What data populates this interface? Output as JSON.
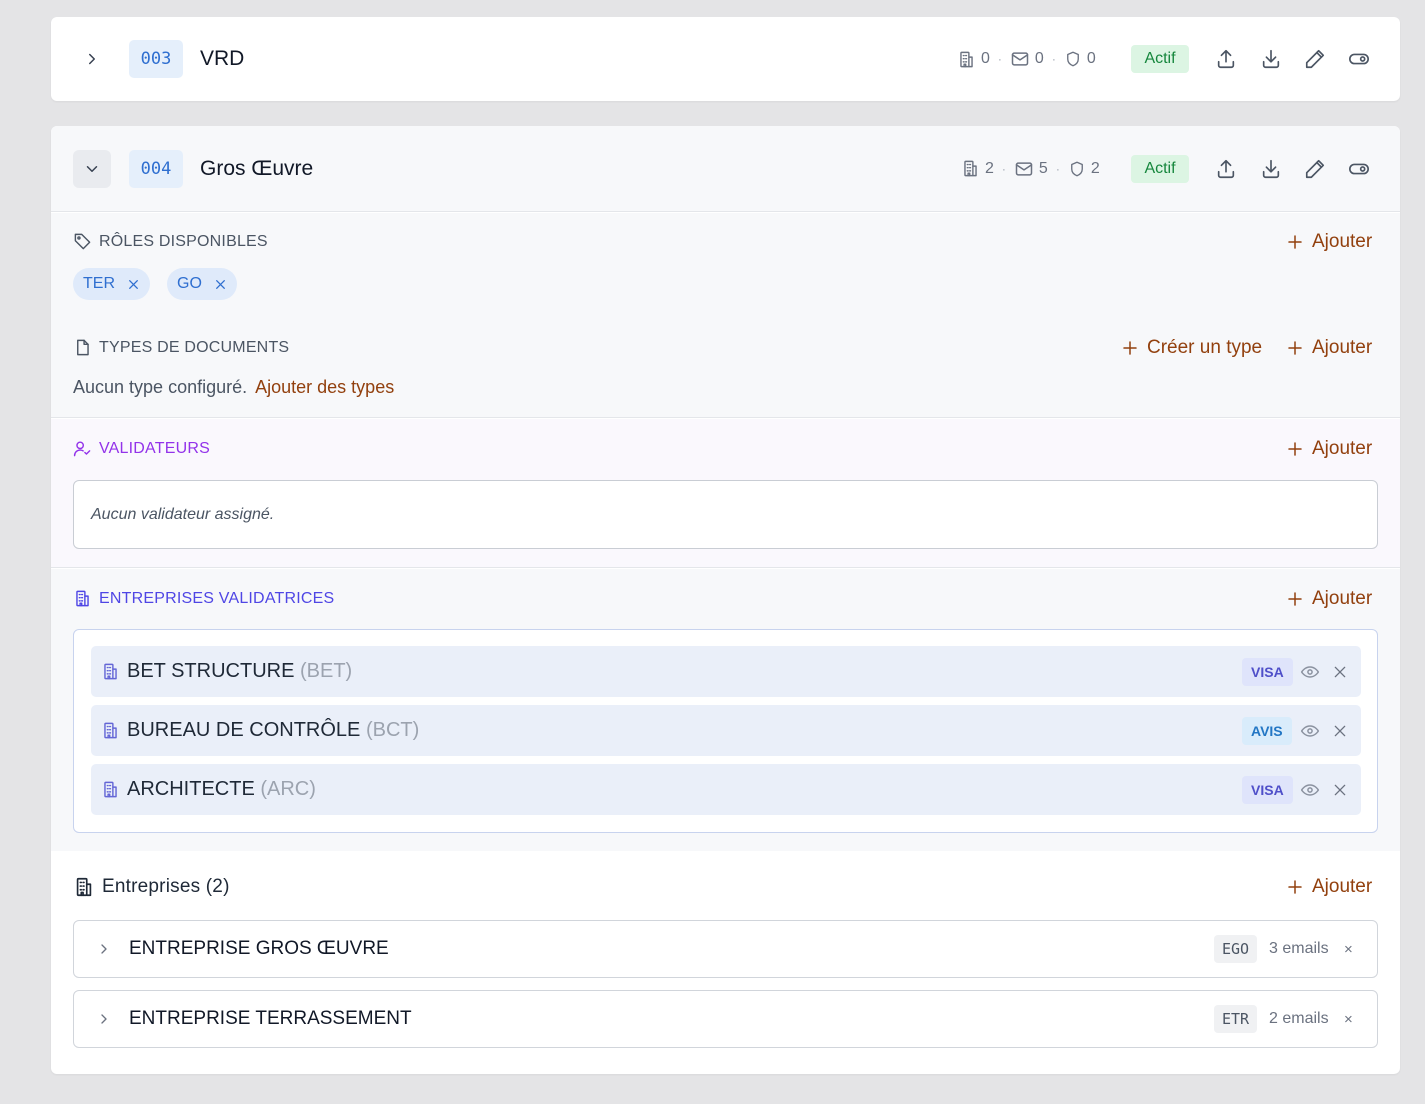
{
  "colors": {
    "accent_link": "#92400e",
    "code_blue": "#2f6fd0",
    "actif_green": "#16873d",
    "validateurs_purple": "#9333ea",
    "entreprises_indigo": "#4f46e5"
  },
  "lots": [
    {
      "code": "003",
      "title": "VRD",
      "expanded": false,
      "stats": {
        "companies": "0",
        "emails": "0",
        "validators": "0"
      },
      "status": "Actif"
    },
    {
      "code": "004",
      "title": "Gros Œuvre",
      "expanded": true,
      "stats": {
        "companies": "2",
        "emails": "5",
        "validators": "2"
      },
      "status": "Actif",
      "roles": {
        "label": "RÔLES DISPONIBLES",
        "add_label": "Ajouter",
        "chips": [
          "TER",
          "GO"
        ]
      },
      "doc_types": {
        "label": "TYPES DE DOCUMENTS",
        "create_label": "Créer un type",
        "add_label": "Ajouter",
        "empty_text": "Aucun type configuré.",
        "empty_link": "Ajouter des types"
      },
      "validators": {
        "label": "VALIDATEURS",
        "add_label": "Ajouter",
        "empty_text": "Aucun validateur assigné."
      },
      "validating_companies": {
        "label": "ENTREPRISES VALIDATRICES",
        "add_label": "Ajouter",
        "items": [
          {
            "name": "BET STRUCTURE",
            "abbr": "(BET)",
            "role": "VISA"
          },
          {
            "name": "BUREAU DE CONTRÔLE",
            "abbr": "(BCT)",
            "role": "AVIS"
          },
          {
            "name": "ARCHITECTE",
            "abbr": "(ARC)",
            "role": "VISA"
          }
        ]
      },
      "companies": {
        "label": "Entreprises (2)",
        "add_label": "Ajouter",
        "items": [
          {
            "name": "ENTREPRISE GROS ŒUVRE",
            "code": "EGO",
            "emails": "3 emails"
          },
          {
            "name": "ENTREPRISE TERRASSEMENT",
            "code": "ETR",
            "emails": "2 emails"
          }
        ]
      }
    }
  ],
  "icons": {
    "chevron_closed": "chevron-right-icon",
    "chevron_open": "chevron-down-icon",
    "stat_companies": "building-icon",
    "stat_emails": "mail-icon",
    "stat_validators": "shield-icon",
    "upload": "upload-icon",
    "download": "download-icon",
    "edit": "pencil-icon",
    "toggle": "toggle-icon"
  }
}
